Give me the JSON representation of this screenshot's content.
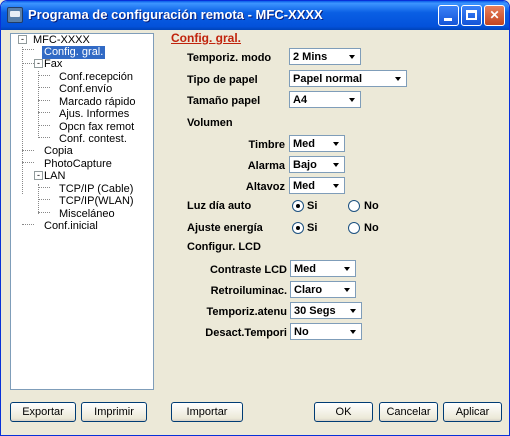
{
  "window": {
    "title": "Programa de configuración remota - MFC-XXXX"
  },
  "tree": {
    "root": "MFC-XXXX",
    "items": [
      "Config. gral.",
      "Fax",
      "Conf.recepción",
      "Conf.envío",
      "Marcado rápido",
      "Ajus. Informes",
      "Opcn fax remot",
      "Conf. contest.",
      "Copia",
      "PhotoCapture",
      "LAN",
      "TCP/IP (Cable)",
      "TCP/IP(WLAN)",
      "Misceláneo",
      "Conf.inicial"
    ]
  },
  "settings": {
    "title": "Config. gral.",
    "temporiz_modo": {
      "label": "Temporiz. modo",
      "value": "2 Mins"
    },
    "tipo_papel": {
      "label": "Tipo de papel",
      "value": "Papel normal"
    },
    "tamano_papel": {
      "label": "Tamaño papel",
      "value": "A4"
    },
    "volumen_header": "Volumen",
    "timbre": {
      "label": "Timbre",
      "value": "Med"
    },
    "alarma": {
      "label": "Alarma",
      "value": "Bajo"
    },
    "altavoz": {
      "label": "Altavoz",
      "value": "Med"
    },
    "luz_dia": {
      "label": "Luz día auto",
      "si": "Si",
      "no": "No"
    },
    "ajuste_energia": {
      "label": "Ajuste energía",
      "si": "Si",
      "no": "No"
    },
    "lcd_header": "Configur. LCD",
    "contraste": {
      "label": "Contraste LCD",
      "value": "Med"
    },
    "retroilum": {
      "label": "Retroiluminac.",
      "value": "Claro"
    },
    "temporiz_atenu": {
      "label": "Temporiz.atenu",
      "value": "30 Segs"
    },
    "desact": {
      "label": "Desact.Tempori",
      "value": "No"
    }
  },
  "buttons": {
    "exportar": "Exportar",
    "imprimir": "Imprimir",
    "importar": "Importar",
    "ok": "OK",
    "cancelar": "Cancelar",
    "aplicar": "Aplicar"
  }
}
